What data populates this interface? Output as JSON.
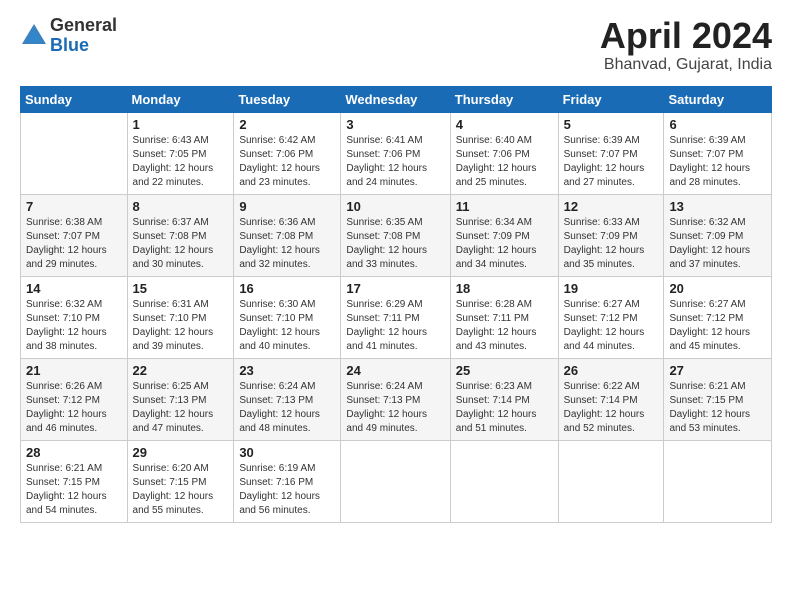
{
  "logo": {
    "general": "General",
    "blue": "Blue"
  },
  "title": "April 2024",
  "subtitle": "Bhanvad, Gujarat, India",
  "days_of_week": [
    "Sunday",
    "Monday",
    "Tuesday",
    "Wednesday",
    "Thursday",
    "Friday",
    "Saturday"
  ],
  "weeks": [
    [
      {
        "day": "",
        "content": ""
      },
      {
        "day": "1",
        "content": "Sunrise: 6:43 AM\nSunset: 7:05 PM\nDaylight: 12 hours\nand 22 minutes."
      },
      {
        "day": "2",
        "content": "Sunrise: 6:42 AM\nSunset: 7:06 PM\nDaylight: 12 hours\nand 23 minutes."
      },
      {
        "day": "3",
        "content": "Sunrise: 6:41 AM\nSunset: 7:06 PM\nDaylight: 12 hours\nand 24 minutes."
      },
      {
        "day": "4",
        "content": "Sunrise: 6:40 AM\nSunset: 7:06 PM\nDaylight: 12 hours\nand 25 minutes."
      },
      {
        "day": "5",
        "content": "Sunrise: 6:39 AM\nSunset: 7:07 PM\nDaylight: 12 hours\nand 27 minutes."
      },
      {
        "day": "6",
        "content": "Sunrise: 6:39 AM\nSunset: 7:07 PM\nDaylight: 12 hours\nand 28 minutes."
      }
    ],
    [
      {
        "day": "7",
        "content": "Sunrise: 6:38 AM\nSunset: 7:07 PM\nDaylight: 12 hours\nand 29 minutes."
      },
      {
        "day": "8",
        "content": "Sunrise: 6:37 AM\nSunset: 7:08 PM\nDaylight: 12 hours\nand 30 minutes."
      },
      {
        "day": "9",
        "content": "Sunrise: 6:36 AM\nSunset: 7:08 PM\nDaylight: 12 hours\nand 32 minutes."
      },
      {
        "day": "10",
        "content": "Sunrise: 6:35 AM\nSunset: 7:08 PM\nDaylight: 12 hours\nand 33 minutes."
      },
      {
        "day": "11",
        "content": "Sunrise: 6:34 AM\nSunset: 7:09 PM\nDaylight: 12 hours\nand 34 minutes."
      },
      {
        "day": "12",
        "content": "Sunrise: 6:33 AM\nSunset: 7:09 PM\nDaylight: 12 hours\nand 35 minutes."
      },
      {
        "day": "13",
        "content": "Sunrise: 6:32 AM\nSunset: 7:09 PM\nDaylight: 12 hours\nand 37 minutes."
      }
    ],
    [
      {
        "day": "14",
        "content": "Sunrise: 6:32 AM\nSunset: 7:10 PM\nDaylight: 12 hours\nand 38 minutes."
      },
      {
        "day": "15",
        "content": "Sunrise: 6:31 AM\nSunset: 7:10 PM\nDaylight: 12 hours\nand 39 minutes."
      },
      {
        "day": "16",
        "content": "Sunrise: 6:30 AM\nSunset: 7:10 PM\nDaylight: 12 hours\nand 40 minutes."
      },
      {
        "day": "17",
        "content": "Sunrise: 6:29 AM\nSunset: 7:11 PM\nDaylight: 12 hours\nand 41 minutes."
      },
      {
        "day": "18",
        "content": "Sunrise: 6:28 AM\nSunset: 7:11 PM\nDaylight: 12 hours\nand 43 minutes."
      },
      {
        "day": "19",
        "content": "Sunrise: 6:27 AM\nSunset: 7:12 PM\nDaylight: 12 hours\nand 44 minutes."
      },
      {
        "day": "20",
        "content": "Sunrise: 6:27 AM\nSunset: 7:12 PM\nDaylight: 12 hours\nand 45 minutes."
      }
    ],
    [
      {
        "day": "21",
        "content": "Sunrise: 6:26 AM\nSunset: 7:12 PM\nDaylight: 12 hours\nand 46 minutes."
      },
      {
        "day": "22",
        "content": "Sunrise: 6:25 AM\nSunset: 7:13 PM\nDaylight: 12 hours\nand 47 minutes."
      },
      {
        "day": "23",
        "content": "Sunrise: 6:24 AM\nSunset: 7:13 PM\nDaylight: 12 hours\nand 48 minutes."
      },
      {
        "day": "24",
        "content": "Sunrise: 6:24 AM\nSunset: 7:13 PM\nDaylight: 12 hours\nand 49 minutes."
      },
      {
        "day": "25",
        "content": "Sunrise: 6:23 AM\nSunset: 7:14 PM\nDaylight: 12 hours\nand 51 minutes."
      },
      {
        "day": "26",
        "content": "Sunrise: 6:22 AM\nSunset: 7:14 PM\nDaylight: 12 hours\nand 52 minutes."
      },
      {
        "day": "27",
        "content": "Sunrise: 6:21 AM\nSunset: 7:15 PM\nDaylight: 12 hours\nand 53 minutes."
      }
    ],
    [
      {
        "day": "28",
        "content": "Sunrise: 6:21 AM\nSunset: 7:15 PM\nDaylight: 12 hours\nand 54 minutes."
      },
      {
        "day": "29",
        "content": "Sunrise: 6:20 AM\nSunset: 7:15 PM\nDaylight: 12 hours\nand 55 minutes."
      },
      {
        "day": "30",
        "content": "Sunrise: 6:19 AM\nSunset: 7:16 PM\nDaylight: 12 hours\nand 56 minutes."
      },
      {
        "day": "",
        "content": ""
      },
      {
        "day": "",
        "content": ""
      },
      {
        "day": "",
        "content": ""
      },
      {
        "day": "",
        "content": ""
      }
    ]
  ]
}
